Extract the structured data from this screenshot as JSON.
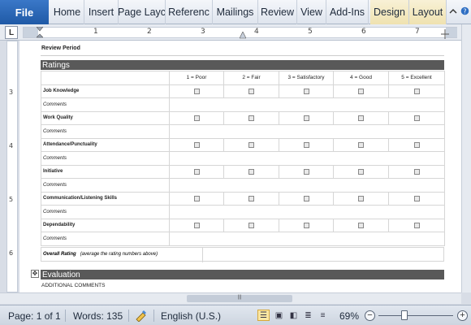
{
  "ribbon": {
    "file_label": "File",
    "tabs": [
      {
        "label": "Home"
      },
      {
        "label": "Insert"
      },
      {
        "label": "Page Layc"
      },
      {
        "label": "Referenc"
      },
      {
        "label": "Mailings"
      },
      {
        "label": "Review"
      },
      {
        "label": "View"
      },
      {
        "label": "Add-Ins"
      },
      {
        "label": "Design"
      },
      {
        "label": "Layout"
      }
    ],
    "caret_icon": "chevron-up-icon",
    "help_icon": "help-icon"
  },
  "ruler": {
    "corner": "L",
    "h_numbers": [
      "1",
      "2",
      "3",
      "4",
      "5",
      "6",
      "7"
    ],
    "v_numbers": [
      "3",
      "4",
      "5",
      "6"
    ]
  },
  "document": {
    "review_period": "Review Period",
    "ratings_heading": "Ratings",
    "scale": [
      "1 = Poor",
      "2 = Fair",
      "3 = Satisfactory",
      "4 = Good",
      "5 = Excellent"
    ],
    "criteria": [
      {
        "label": "Job Knowledge",
        "comments": "Comments"
      },
      {
        "label": "Work Quality",
        "comments": "Comments"
      },
      {
        "label": "Attendance/Punctuality",
        "comments": "Comments"
      },
      {
        "label": "Initiative",
        "comments": "Comments"
      },
      {
        "label": "Communication/Listening   Skills",
        "comments": "Comments"
      },
      {
        "label": "Dependability",
        "comments": "Comments"
      }
    ],
    "overall_label": "Overall  Rating",
    "overall_note": "(average  the rating numbers  above)",
    "evaluation_heading": "Evaluation",
    "additional_comments": "ADDITIONAL  COMMENTS"
  },
  "statusbar": {
    "page": "Page: 1 of 1",
    "words": "Words: 135",
    "language": "English (U.S.)",
    "zoom": "69%",
    "zoom_minus": "−",
    "zoom_plus": "+"
  }
}
